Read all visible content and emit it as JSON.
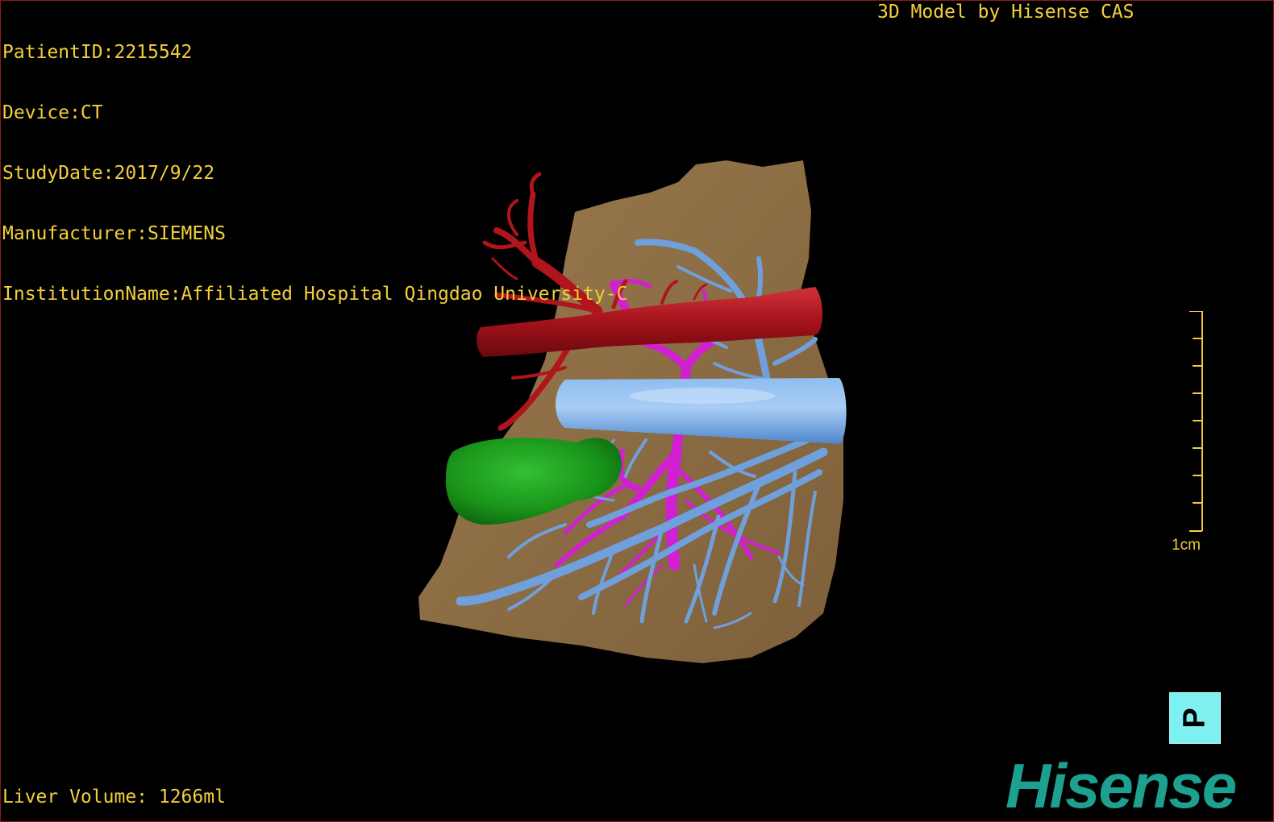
{
  "overlay": {
    "patient_id": "PatientID:2215542",
    "device": "Device:CT",
    "study_date": "StudyDate:2017/9/22",
    "manufacturer": "Manufacturer:SIEMENS",
    "institution": "InstitutionName:Affiliated Hospital Qingdao University-C",
    "credit": "3D Model by Hisense CAS",
    "liver_volume": "Liver Volume: 1266ml"
  },
  "scale_bar": {
    "label": "1cm"
  },
  "orientation_cube": {
    "label": "P"
  },
  "logo": {
    "text": "Hisense"
  },
  "colors": {
    "overlay_text": "#f2cf3a",
    "liver": "#8a6b43",
    "hepatic_artery_and_aorta": "#b0141c",
    "portal_vein": "#d21fd2",
    "hepatic_veins_and_ivc": "#6fa0dc",
    "gallbladder": "#1c9a1c",
    "orientation_cube": "#7ff0f0",
    "logo": "#1ea090"
  }
}
